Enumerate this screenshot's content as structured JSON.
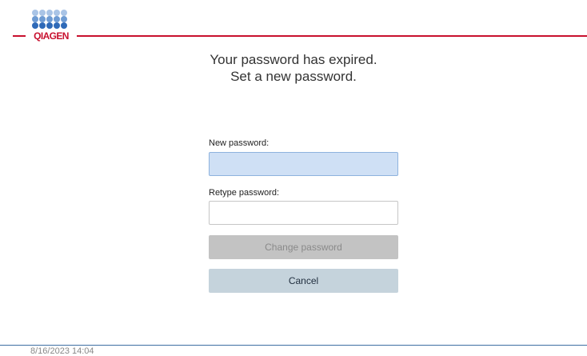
{
  "brand": {
    "name": "QIAGEN",
    "color": "#c8102e",
    "dot_colors": [
      "#a9c4e6",
      "#6e9bd3",
      "#2f6ab8"
    ]
  },
  "heading": {
    "line1": "Your password has expired.",
    "line2": "Set a new password."
  },
  "form": {
    "new_password_label": "New password:",
    "new_password_value": "",
    "retype_password_label": "Retype password:",
    "retype_password_value": "",
    "change_button": "Change password",
    "cancel_button": "Cancel"
  },
  "footer": {
    "timestamp": "8/16/2023 14:04"
  }
}
